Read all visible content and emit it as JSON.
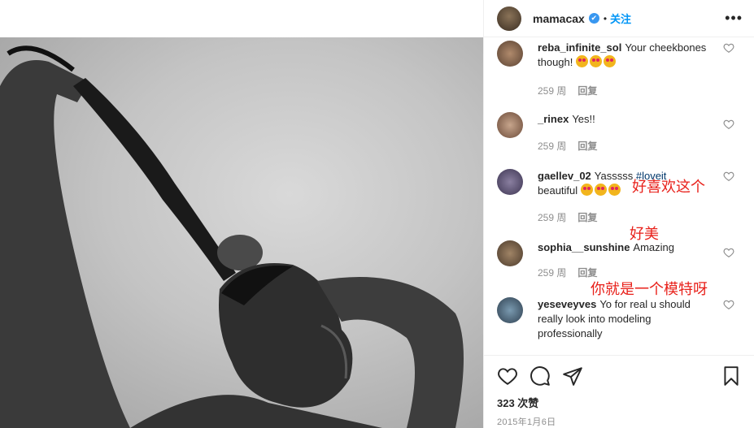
{
  "post": {
    "username": "mamacax",
    "verified_mark": "✔",
    "separator": "•",
    "follow_label": "关注",
    "more_label": "•••",
    "likes": "323 次赞",
    "date": "2015年1月6日"
  },
  "comments": [
    {
      "user": "reba_infinite_sol",
      "text": "Your cheekbones though!",
      "emojis": 3,
      "time": "259 周",
      "reply": "回复"
    },
    {
      "user": "_rinex",
      "text": "Yes!!",
      "emojis": 0,
      "time": "259 周",
      "reply": "回复"
    },
    {
      "user": "gaellev_02",
      "text": "Yasssss",
      "hashtag": "#loveit",
      "text2": "beautiful",
      "emojis": 3,
      "time": "259 周",
      "reply": "回复"
    },
    {
      "user": "sophia__sunshine",
      "text": "Amazing",
      "emojis": 0,
      "time": "259 周",
      "reply": "回复"
    },
    {
      "user": "yeseveyves",
      "text": "Yo for real u should really look into modeling professionally",
      "emojis": 0
    }
  ],
  "annotations": {
    "note1": "好喜欢这个",
    "note2": "好美",
    "note3": "你就是一个模特呀"
  },
  "icons": [
    "heart-icon",
    "comment-icon",
    "share-icon",
    "bookmark-icon",
    "more-icon",
    "verified-icon"
  ],
  "colors": {
    "accent": "#0095f6",
    "annotation": "#e8201a",
    "muted": "#8e8e8e",
    "verified": "#3897f0"
  }
}
